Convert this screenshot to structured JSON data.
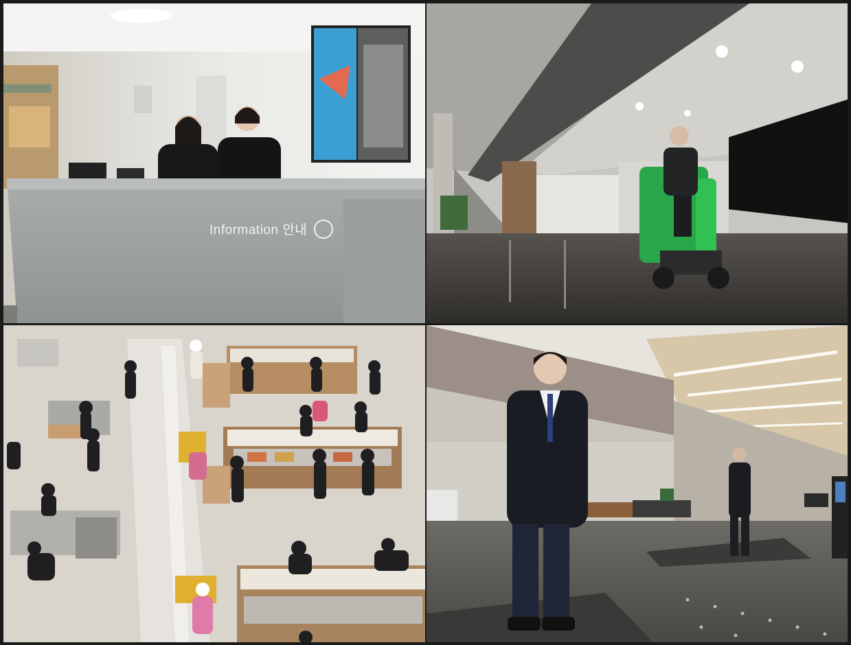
{
  "panels": [
    {
      "id": "information-desk",
      "sign_text": "Information 안내"
    },
    {
      "id": "lobby-floor-cleaning"
    },
    {
      "id": "cafeteria-overhead"
    },
    {
      "id": "lobby-security-guards"
    }
  ]
}
